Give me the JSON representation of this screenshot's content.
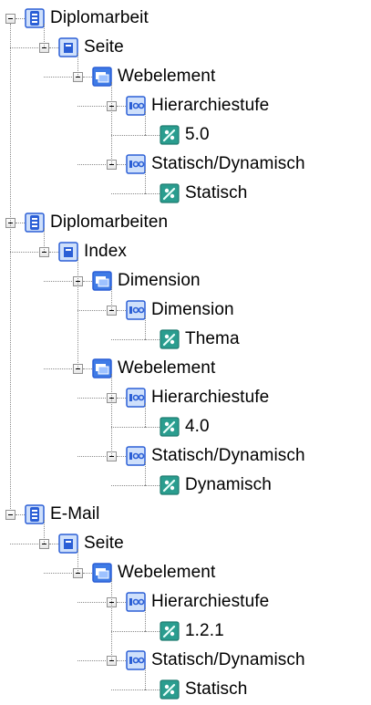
{
  "tree": [
    {
      "label": "Diplomarbeit",
      "icon": "database-icon",
      "children": [
        {
          "label": "Seite",
          "icon": "page-icon",
          "children": [
            {
              "label": "Webelement",
              "icon": "web-element-icon",
              "children": [
                {
                  "label": "Hierarchiestufe",
                  "icon": "attribute-icon",
                  "children": [
                    {
                      "label": "5.0",
                      "icon": "value-icon",
                      "children": []
                    }
                  ]
                },
                {
                  "label": "Statisch/Dynamisch",
                  "icon": "attribute-icon",
                  "children": [
                    {
                      "label": "Statisch",
                      "icon": "value-icon",
                      "children": []
                    }
                  ]
                }
              ]
            }
          ]
        }
      ]
    },
    {
      "label": "Diplomarbeiten",
      "icon": "database-icon",
      "children": [
        {
          "label": "Index",
          "icon": "page-icon",
          "children": [
            {
              "label": "Dimension",
              "icon": "web-element-icon",
              "children": [
                {
                  "label": "Dimension",
                  "icon": "attribute-icon",
                  "children": [
                    {
                      "label": "Thema",
                      "icon": "value-icon",
                      "children": []
                    }
                  ]
                }
              ]
            },
            {
              "label": "Webelement",
              "icon": "web-element-icon",
              "children": [
                {
                  "label": "Hierarchiestufe",
                  "icon": "attribute-icon",
                  "children": [
                    {
                      "label": "4.0",
                      "icon": "value-icon",
                      "children": []
                    }
                  ]
                },
                {
                  "label": "Statisch/Dynamisch",
                  "icon": "attribute-icon",
                  "children": [
                    {
                      "label": "Dynamisch",
                      "icon": "value-icon",
                      "children": []
                    }
                  ]
                }
              ]
            }
          ]
        }
      ]
    },
    {
      "label": "E-Mail",
      "icon": "database-icon",
      "children": [
        {
          "label": "Seite",
          "icon": "page-icon",
          "children": [
            {
              "label": "Webelement",
              "icon": "web-element-icon",
              "children": [
                {
                  "label": "Hierarchiestufe",
                  "icon": "attribute-icon",
                  "children": [
                    {
                      "label": "1.2.1",
                      "icon": "value-icon",
                      "children": []
                    }
                  ]
                },
                {
                  "label": "Statisch/Dynamisch",
                  "icon": "attribute-icon",
                  "children": [
                    {
                      "label": "Statisch",
                      "icon": "value-icon",
                      "children": []
                    }
                  ]
                }
              ]
            }
          ]
        }
      ]
    }
  ],
  "colors": {
    "icon_blue": "#2b5fd6",
    "icon_light": "#cfe0fb",
    "value_teal": "#2a9d8f",
    "tree_line": "#8a8a8a"
  }
}
